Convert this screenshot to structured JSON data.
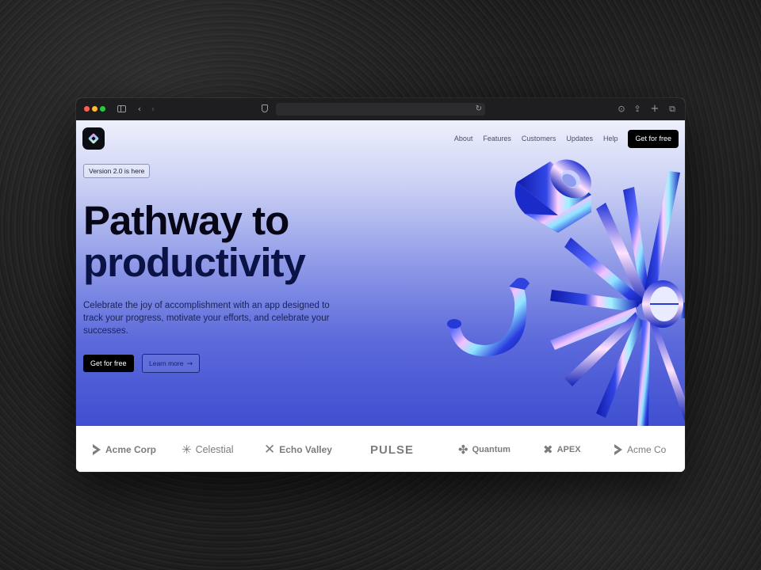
{
  "nav": {
    "items": [
      "About",
      "Features",
      "Customers",
      "Updates",
      "Help"
    ],
    "cta": "Get for free"
  },
  "hero": {
    "badge": "Version 2.0 is here",
    "title_line1": "Pathway to",
    "title_line2": "productivity",
    "subtitle": "Celebrate the joy of accomplishment with an app designed to track your progress, motivate your efforts, and celebrate your successes.",
    "primary_button": "Get for free",
    "secondary_button": "Learn more",
    "secondary_icon": "arrow-right-icon"
  },
  "logos": [
    {
      "name": "Acme Corp",
      "icon": "acme-corp-logo"
    },
    {
      "name": "Celestial",
      "icon": "celestial-logo"
    },
    {
      "name": "Echo Valley",
      "icon": "echo-valley-logo"
    },
    {
      "name": "PULSE",
      "icon": ""
    },
    {
      "name": "Quantum",
      "icon": "quantum-logo"
    },
    {
      "name": "APEX",
      "icon": "apex-logo"
    },
    {
      "name": "Acme Co",
      "icon": "acme-corp-logo"
    }
  ],
  "colors": {
    "hero_top": "#eef0fc",
    "hero_bottom": "#3f4fd0",
    "headline": "#060616",
    "button_dark": "#000000"
  }
}
